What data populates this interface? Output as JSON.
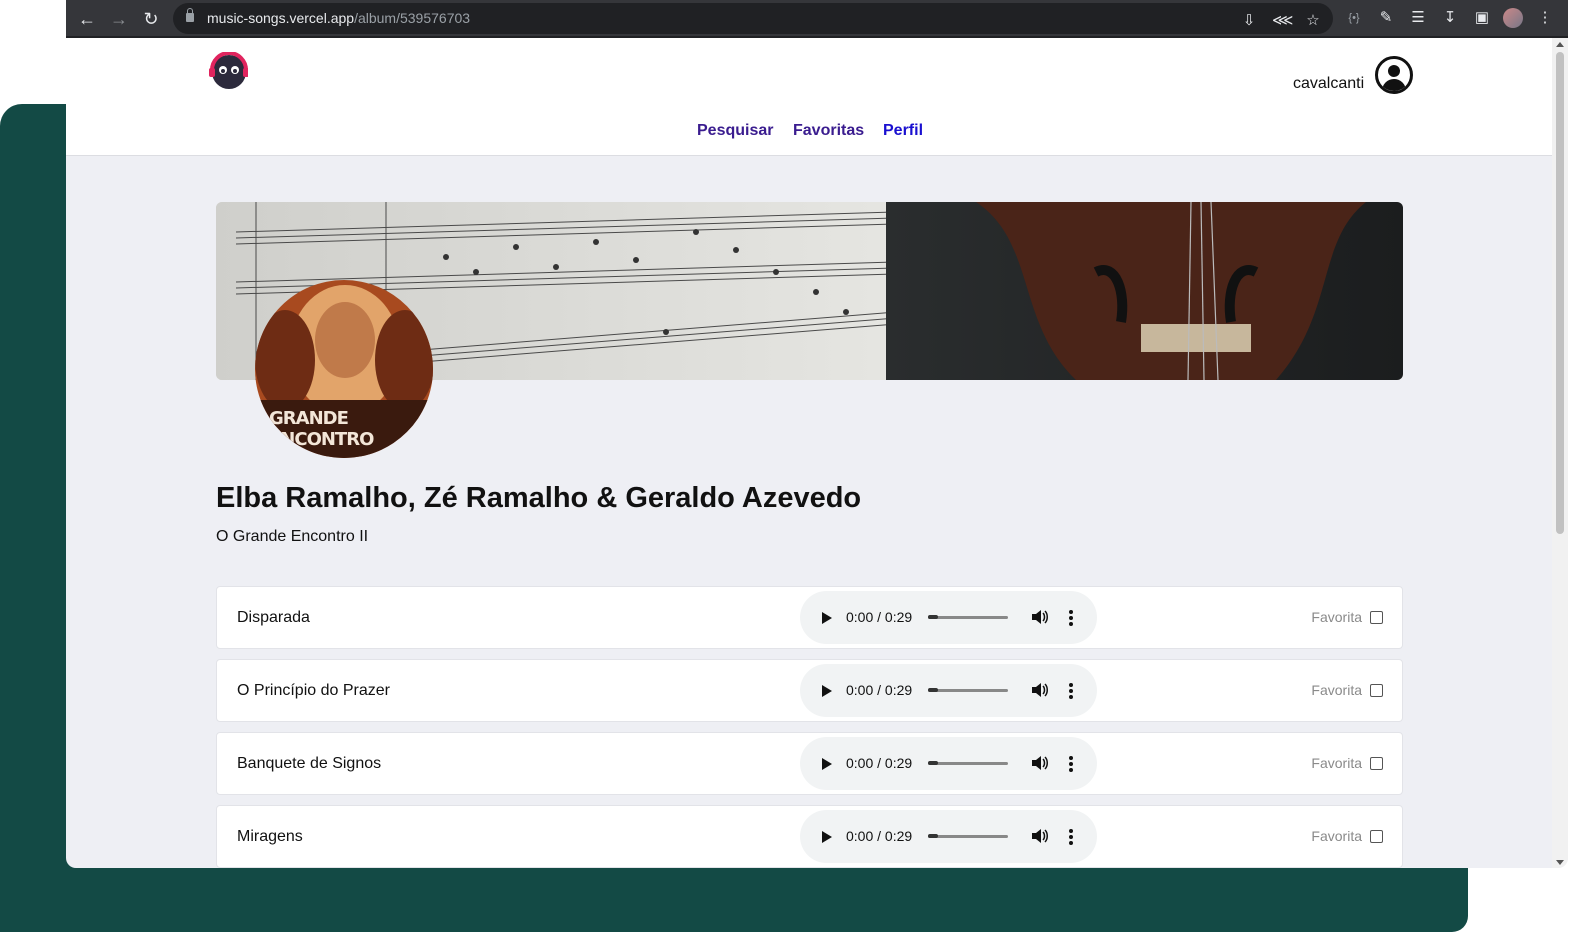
{
  "browser": {
    "url_host": "music-songs.vercel.app",
    "url_path": "/album/539576703"
  },
  "header": {
    "username": "cavalcanti",
    "nav": {
      "search": "Pesquisar",
      "favorites": "Favoritas",
      "profile": "Perfil"
    }
  },
  "album": {
    "artist": "Elba Ramalho, Zé Ramalho & Geraldo Azevedo",
    "name": "O Grande Encontro II",
    "cover_text": "GRANDE ENCONTRO"
  },
  "tracks": [
    {
      "name": "Disparada",
      "time": "0:00 / 0:29",
      "favorite_label": "Favorita",
      "favorite": false
    },
    {
      "name": "O Princípio do Prazer",
      "time": "0:00 / 0:29",
      "favorite_label": "Favorita",
      "favorite": false
    },
    {
      "name": "Banquete de Signos",
      "time": "0:00 / 0:29",
      "favorite_label": "Favorita",
      "favorite": false
    },
    {
      "name": "Miragens",
      "time": "0:00 / 0:29",
      "favorite_label": "Favorita",
      "favorite": false
    }
  ],
  "colors": {
    "background_accent": "#134a45",
    "nav_link": "#3a1c8f",
    "page_bg": "#eeeff4"
  }
}
